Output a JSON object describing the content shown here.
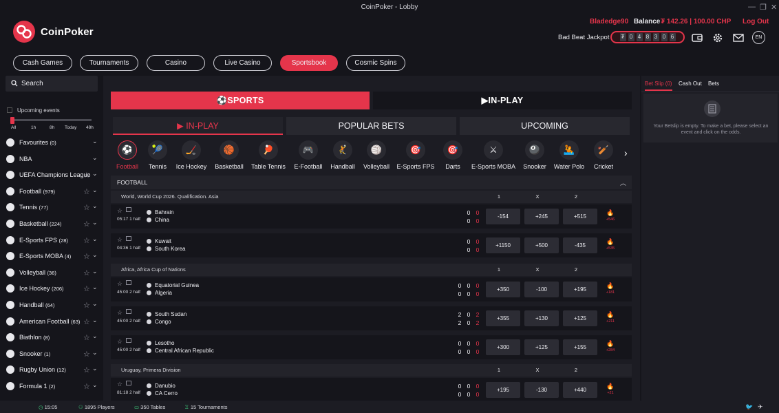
{
  "window": {
    "title": "CoinPoker - Lobby"
  },
  "header": {
    "brand": "CoinPoker",
    "username": "Bladedge90",
    "balance_label": "Balance",
    "balance_value": "₮ 142.26 | 100.00 CHP",
    "logout": "Log Out",
    "jackpot_label": "Bad Beat Jackpot",
    "jackpot_digits": [
      "₮",
      "0",
      "4",
      "8",
      "3",
      "0",
      "6"
    ],
    "language": "EN"
  },
  "nav": [
    {
      "label": "Cash Games"
    },
    {
      "label": "Tournaments"
    },
    {
      "label": "Casino"
    },
    {
      "label": "Live Casino"
    },
    {
      "label": "Sportsbook",
      "active": true
    },
    {
      "label": "Cosmic Spins"
    }
  ],
  "sidebar": {
    "search_label": "Search",
    "upcoming_label": "Upcoming events",
    "time_options": [
      "All",
      "1h",
      "8h",
      "Today",
      "48h"
    ],
    "items": [
      {
        "name": "Favourites",
        "count": "(0)"
      },
      {
        "name": "NBA",
        "count": ""
      },
      {
        "name": "UEFA Champions League",
        "count": ""
      },
      {
        "name": "Football",
        "count": "(979)"
      },
      {
        "name": "Tennis",
        "count": "(77)"
      },
      {
        "name": "Basketball",
        "count": "(224)"
      },
      {
        "name": "E-Sports FPS",
        "count": "(28)"
      },
      {
        "name": "E-Sports MOBA",
        "count": "(4)"
      },
      {
        "name": "Volleyball",
        "count": "(36)"
      },
      {
        "name": "Ice Hockey",
        "count": "(206)"
      },
      {
        "name": "Handball",
        "count": "(64)"
      },
      {
        "name": "American Football",
        "count": "(63)"
      },
      {
        "name": "Biathlon",
        "count": "(8)"
      },
      {
        "name": "Snooker",
        "count": "(1)"
      },
      {
        "name": "Rugby Union",
        "count": "(12)"
      },
      {
        "name": "Formula 1",
        "count": "(2)"
      }
    ]
  },
  "main": {
    "top_tabs": {
      "sports": "SPORTS",
      "inplay": "IN-PLAY"
    },
    "sub_tabs": {
      "inplay": "IN-PLAY",
      "popular": "POPULAR BETS",
      "upcoming": "UPCOMING"
    },
    "sports": [
      {
        "label": "Football",
        "icon": "⚽",
        "active": true
      },
      {
        "label": "Tennis",
        "icon": "🎾"
      },
      {
        "label": "Ice Hockey",
        "icon": "🏒"
      },
      {
        "label": "Basketball",
        "icon": "🏀"
      },
      {
        "label": "Table Tennis",
        "icon": "🏓"
      },
      {
        "label": "E-Football",
        "icon": "🎮"
      },
      {
        "label": "Handball",
        "icon": "🤾"
      },
      {
        "label": "Volleyball",
        "icon": "🏐"
      },
      {
        "label": "E-Sports FPS",
        "icon": "🎯"
      },
      {
        "label": "Darts",
        "icon": "🎯"
      },
      {
        "label": "E-Sports MOBA",
        "icon": "⚔"
      },
      {
        "label": "Snooker",
        "icon": "🎱"
      },
      {
        "label": "Water Polo",
        "icon": "🤽"
      },
      {
        "label": "Cricket",
        "icon": "🏏"
      }
    ],
    "section_title": "FOOTBALL",
    "col_headers": [
      "1",
      "X",
      "2"
    ],
    "leagues": [
      {
        "name": "World, World Cup 2026. Qualification. Asia",
        "matches": [
          {
            "time": "05:17  1 half",
            "home": "Bahrain",
            "away": "China",
            "s1": [
              "0",
              "0"
            ],
            "s2": [
              "0",
              "0"
            ],
            "odds": [
              "-154",
              "+245",
              "+515"
            ],
            "fire": "+546"
          },
          {
            "time": "04:36  1 half",
            "home": "Kuwait",
            "away": "South Korea",
            "s1": [
              "0",
              "0"
            ],
            "s2": [
              "0",
              "0"
            ],
            "odds": [
              "+1150",
              "+500",
              "-435"
            ],
            "fire": "+535"
          }
        ]
      },
      {
        "name": "Africa, Africa Cup of Nations",
        "matches": [
          {
            "time": "45:00  2 half",
            "home": "Equatorial Guinea",
            "away": "Algeria",
            "s1": [
              "0",
              "0",
              "0"
            ],
            "s2": [
              "0",
              "0",
              "0"
            ],
            "odds": [
              "+350",
              "-100",
              "+195"
            ],
            "fire": "+181"
          },
          {
            "time": "45:00  2 half",
            "home": "South Sudan",
            "away": "Congo",
            "s1": [
              "2",
              "0",
              "2"
            ],
            "s2": [
              "2",
              "0",
              "2"
            ],
            "odds": [
              "+355",
              "+130",
              "+125"
            ],
            "fire": "+211"
          },
          {
            "time": "45:00  2 half",
            "home": "Lesotho",
            "away": "Central African Republic",
            "s1": [
              "0",
              "0",
              "0"
            ],
            "s2": [
              "0",
              "0",
              "0"
            ],
            "odds": [
              "+300",
              "+125",
              "+155"
            ],
            "fire": "+284"
          }
        ]
      },
      {
        "name": "Uruguay, Primera Division",
        "matches": [
          {
            "time": "81:18  2 half",
            "home": "Danubio",
            "away": "CA Cerro",
            "s1": [
              "0",
              "0",
              "0"
            ],
            "s2": [
              "0",
              "0",
              "0"
            ],
            "odds": [
              "+195",
              "-130",
              "+440"
            ],
            "fire": "+21"
          }
        ]
      }
    ]
  },
  "betslip": {
    "tabs": [
      "Bet Slip (0)",
      "Cash Out",
      "Bets"
    ],
    "empty_message": "Your Betslip is empty. To make a bet, please select an event and click on the odds."
  },
  "footer": {
    "time": "15:05",
    "players": "1895 Players",
    "tables": "350 Tables",
    "tournaments": "15 Tournaments"
  },
  "colors": {
    "accent": "#e5354b",
    "bg": "#15151b",
    "panel": "#1c1c23",
    "online": "#3ec77a"
  }
}
